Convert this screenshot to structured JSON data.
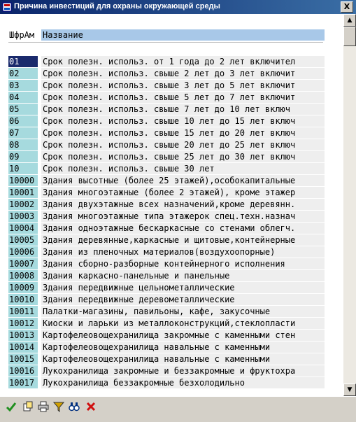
{
  "window": {
    "title": "Причина инвестиций для охраны окружающей среды",
    "close_label": "X"
  },
  "header": {
    "code": "ШфрАм",
    "name": "Название"
  },
  "rows": [
    {
      "code": "01",
      "name": "Срок полезн. использ. от 1 года до 2 лет включител"
    },
    {
      "code": "02",
      "name": "Срок полезн. использ. свыше 2 лет до 3 лет включит"
    },
    {
      "code": "03",
      "name": "Срок полезн. использ. свыше 3 лет до 5 лет включит"
    },
    {
      "code": "04",
      "name": "Срок полезн. использ. свыше 5 лет до 7 лет включит"
    },
    {
      "code": "05",
      "name": "Срок полезн. использ. свыше 7 лет до 10 лет включ"
    },
    {
      "code": "06",
      "name": "Срок полезн. использ. свыше 10 лет до 15 лет включ"
    },
    {
      "code": "07",
      "name": "Срок полезн. использ. свыше 15 лет до 20 лет включ"
    },
    {
      "code": "08",
      "name": "Срок полезн. использ. свыше 20 лет до 25 лет включ"
    },
    {
      "code": "09",
      "name": "Срок полезн. использ. свыше 25 лет до 30 лет включ"
    },
    {
      "code": "10",
      "name": "Срок полезн. использ. свыше 30 лет"
    },
    {
      "code": "10000",
      "name": "Здания высотные (более 25 этажей),особокапитальные"
    },
    {
      "code": "10001",
      "name": "Здания многоэтажные (более 2 этажей), кроме этажер"
    },
    {
      "code": "10002",
      "name": "Здания двухэтажные всех назначений,кроме деревянн."
    },
    {
      "code": "10003",
      "name": "Здания многоэтажные типа этажерок спец.техн.назнач"
    },
    {
      "code": "10004",
      "name": "Здания одноэтажные бескаркасные со стенами облегч."
    },
    {
      "code": "10005",
      "name": "Здания деревянные,каркасные и щитовые,контейнерные"
    },
    {
      "code": "10006",
      "name": "Здания из пленочных материалов(воздухоопорные)"
    },
    {
      "code": "10007",
      "name": "Здания сборно-разборные контейнерного исполнения"
    },
    {
      "code": "10008",
      "name": "Здания каркасно-панельные и панельные"
    },
    {
      "code": "10009",
      "name": "Здания передвижные цельнометаллические"
    },
    {
      "code": "10010",
      "name": "Здания передвижные деревометаллические"
    },
    {
      "code": "10011",
      "name": "Палатки-магазины, павильоны, кафе, закусочные"
    },
    {
      "code": "10012",
      "name": "Киоски и ларьки из металлоконструкций,стеклопласти"
    },
    {
      "code": "10013",
      "name": "Картофелеовощехранилища закромные с каменными стен"
    },
    {
      "code": "10014",
      "name": "Картофелеовощехранилища навальные с каменными"
    },
    {
      "code": "10015",
      "name": "Картофелеовощехранилища навальные с каменными"
    },
    {
      "code": "10016",
      "name": "Лукохранилища закромные и беззакромные и фруктохра"
    },
    {
      "code": "10017",
      "name": "Лукохранилища беззакромные          безхолодильно"
    }
  ],
  "selected_index": 0,
  "toolbar": [
    {
      "icon": "checkmark-icon",
      "name": "confirm-button"
    },
    {
      "icon": "new-entries-icon",
      "name": "new-entry-button"
    },
    {
      "icon": "print-icon",
      "name": "print-button"
    },
    {
      "icon": "filter-icon",
      "name": "filter-button"
    },
    {
      "icon": "binoculars-icon",
      "name": "find-button"
    },
    {
      "icon": "cancel-icon",
      "name": "cancel-button"
    }
  ],
  "colors": {
    "code_bg": "#a6dade",
    "selected_bg": "#1a2a6c",
    "name_bg": "#eeeeee",
    "header_bg": "#a8c8e8"
  }
}
